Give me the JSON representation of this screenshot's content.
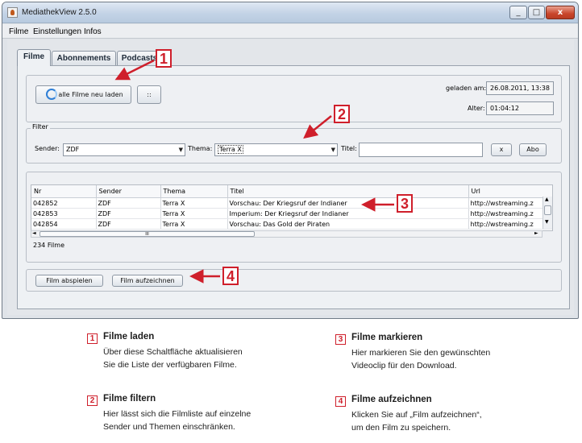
{
  "window": {
    "title": "MediathekView 2.5.0",
    "close_label": "x",
    "minimize_label": "_",
    "maximize_label": "□"
  },
  "menu": [
    "Filme",
    "Einstellungen",
    "Infos"
  ],
  "tabs": [
    "Filme",
    "Abonnements",
    "Podcasts"
  ],
  "load": {
    "reload_button": "alle Filme neu laden",
    "extra_button": "::",
    "loaded_label": "geladen am:",
    "loaded_value": "26.08.2011, 13:38",
    "age_label": "Alter:",
    "age_value": "01:04:12"
  },
  "filter": {
    "group_label": "Filter",
    "sender_label": "Sender:",
    "sender_value": "ZDF",
    "thema_label": "Thema:",
    "thema_value": "Terra X",
    "titel_label": "Titel:",
    "titel_value": "",
    "clear_button": "x",
    "abo_button": "Abo"
  },
  "table": {
    "columns": [
      "Nr",
      "Sender",
      "Thema",
      "Titel",
      "Url"
    ],
    "rows": [
      [
        "042852",
        "ZDF",
        "Terra X",
        "Vorschau: Der Kriegsruf der Indianer",
        "http://wstreaming.z"
      ],
      [
        "042853",
        "ZDF",
        "Terra X",
        "Imperium: Der Kriegsruf der Indianer",
        "http://wstreaming.z"
      ],
      [
        "042854",
        "ZDF",
        "Terra X",
        "Vorschau: Das Gold der Piraten",
        "http://wstreaming.z"
      ]
    ],
    "count_text": "234 Filme",
    "hscroll_grip": "III"
  },
  "actions": {
    "play_button": "Film abspielen",
    "record_button": "Film aufzeichnen"
  },
  "callouts": [
    "1",
    "2",
    "3",
    "4"
  ],
  "legend": [
    {
      "num": "1",
      "title": "Filme laden",
      "lines": [
        "Über diese Schaltfläche aktualisieren",
        "Sie die Liste der verfügbaren Filme."
      ]
    },
    {
      "num": "2",
      "title": "Filme filtern",
      "lines": [
        "Hier lässt sich die Filmliste auf einzelne",
        "Sender und Themen einschränken."
      ]
    },
    {
      "num": "3",
      "title": "Filme markieren",
      "lines": [
        "Hier markieren Sie den gewünschten",
        "Videoclip für den Download."
      ]
    },
    {
      "num": "4",
      "title": "Filme aufzeichnen",
      "lines": [
        "Klicken Sie auf „Film aufzeichnen“,",
        "um den Film zu speichern."
      ]
    }
  ],
  "colors": {
    "callout": "#cf1f2b",
    "window_bg": "#e3e6ea"
  }
}
